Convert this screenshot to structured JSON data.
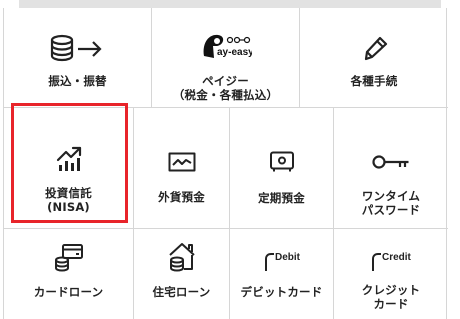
{
  "menu": {
    "row1": [
      {
        "id": "transfer",
        "label": "振込・振替",
        "icon": "database-arrow-icon"
      },
      {
        "id": "payeasy",
        "label": "ペイジー\n（税金・各種払込）",
        "icon": "payeasy-logo",
        "logo_text": "ay-easy"
      },
      {
        "id": "procedures",
        "label": "各種手続",
        "icon": "pencil-icon"
      }
    ],
    "row2": [
      {
        "id": "nisa",
        "label": "投資信託\n(NISA)",
        "icon": "growth-chart-icon",
        "highlighted": true
      },
      {
        "id": "fx-deposit",
        "label": "外貨預金",
        "icon": "line-chart-icon"
      },
      {
        "id": "time-deposit",
        "label": "定期預金",
        "icon": "safe-icon"
      },
      {
        "id": "one-time-password",
        "label": "ワンタイム\nパスワード",
        "icon": "key-icon"
      }
    ],
    "row3": [
      {
        "id": "card-loan",
        "label": "カードローン",
        "icon": "card-coins-icon"
      },
      {
        "id": "housing-loan",
        "label": "住宅ローン",
        "icon": "house-coins-icon"
      },
      {
        "id": "debit-card",
        "label": "デビットカード",
        "icon": "debit-card-icon",
        "tag": "Debit"
      },
      {
        "id": "credit-card",
        "label": "クレジット\nカード",
        "icon": "credit-card-icon",
        "tag": "Credit"
      }
    ]
  },
  "highlight_color": "#e8242a"
}
